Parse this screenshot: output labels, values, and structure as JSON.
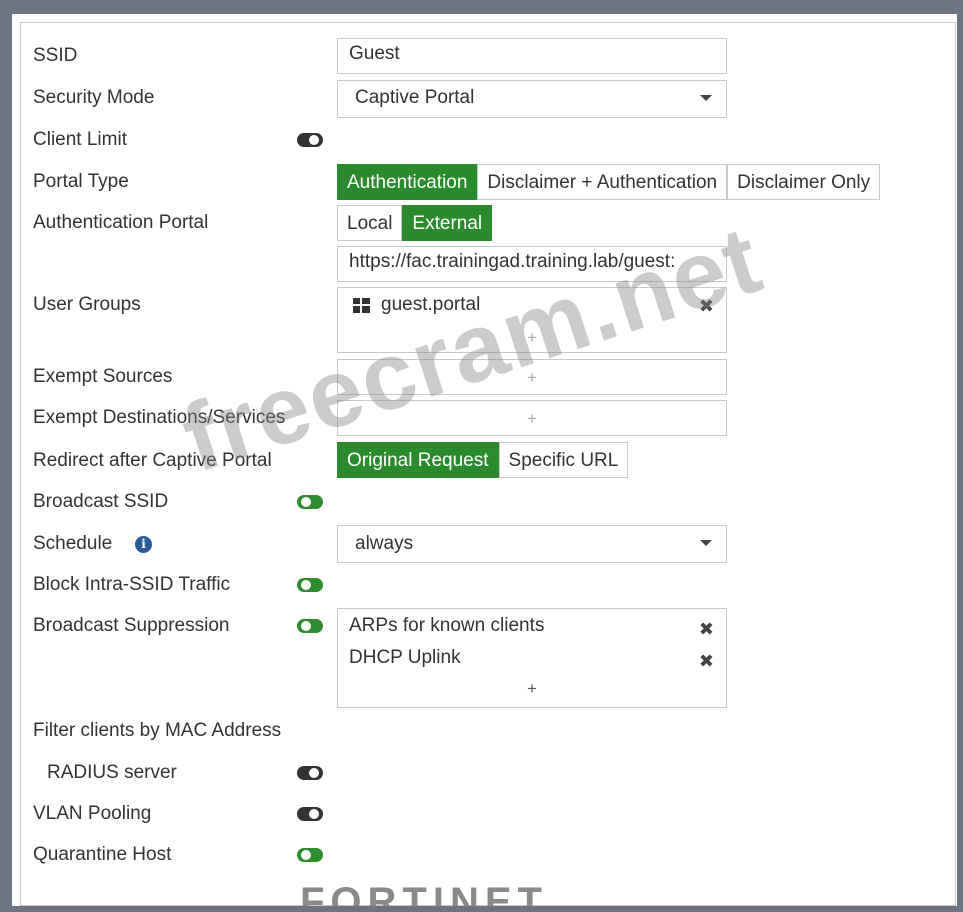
{
  "labels": {
    "ssid": "SSID",
    "security_mode": "Security Mode",
    "client_limit": "Client Limit",
    "portal_type": "Portal Type",
    "authentication_portal": "Authentication Portal",
    "user_groups": "User Groups",
    "exempt_sources": "Exempt Sources",
    "exempt_destinations": "Exempt Destinations/Services",
    "redirect_after": "Redirect after Captive Portal",
    "broadcast_ssid": "Broadcast SSID",
    "schedule": "Schedule",
    "block_intra_ssid": "Block Intra-SSID Traffic",
    "broadcast_suppression": "Broadcast Suppression",
    "filter_clients": "Filter clients by MAC Address",
    "radius_server": "RADIUS server",
    "vlan_pooling": "VLAN Pooling",
    "quarantine_host": "Quarantine Host"
  },
  "values": {
    "ssid": "Guest",
    "security_mode": "Captive Portal",
    "portal_url": "https://fac.trainingad.training.lab/guest:",
    "schedule": "always"
  },
  "portal_type_options": [
    "Authentication",
    "Disclaimer + Authentication",
    "Disclaimer Only"
  ],
  "auth_portal_options": [
    "Local",
    "External"
  ],
  "redirect_options": [
    "Original Request",
    "Specific URL"
  ],
  "user_groups": [
    "guest.portal"
  ],
  "broadcast_suppression": [
    "ARPs for known clients",
    "DHCP Uplink"
  ],
  "toggles": {
    "client_limit": "off",
    "broadcast_ssid": "on",
    "block_intra_ssid": "on",
    "broadcast_suppression": "on",
    "radius_server": "off",
    "vlan_pooling": "off",
    "quarantine_host": "on"
  },
  "icons": {
    "add": "+",
    "remove": "✖",
    "info": "i"
  },
  "colors": {
    "accent_green": "#2b8a2b",
    "info_blue": "#2a5c9a"
  },
  "watermark": "freecram.net",
  "logo": "FORTINET"
}
